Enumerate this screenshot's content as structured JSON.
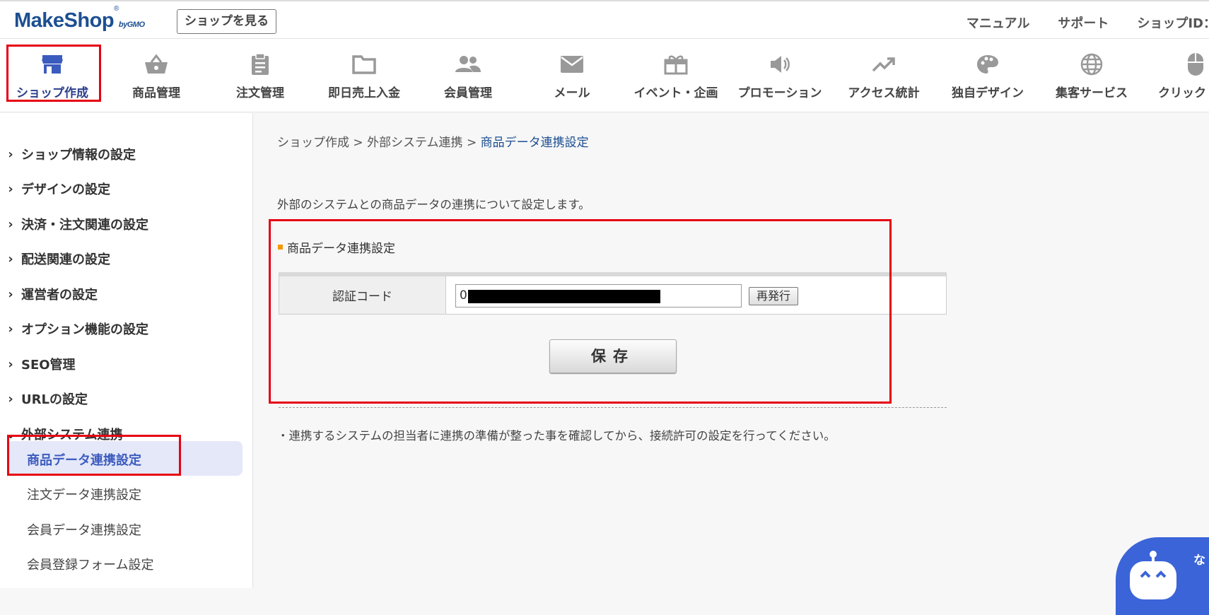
{
  "header": {
    "logo_main": "MakeShop",
    "logo_reg": "®",
    "logo_by": "byGMO",
    "view_shop_label": "ショップを見る",
    "links": [
      "マニュアル",
      "サポート",
      "ショップID："
    ]
  },
  "nav": {
    "items": [
      {
        "label": "ショップ作成",
        "icon": "store-icon",
        "active": true
      },
      {
        "label": "商品管理",
        "icon": "basket-icon"
      },
      {
        "label": "注文管理",
        "icon": "clipboard-icon"
      },
      {
        "label": "即日売上入金",
        "icon": "folder-icon"
      },
      {
        "label": "会員管理",
        "icon": "users-icon"
      },
      {
        "label": "メール",
        "icon": "mail-icon"
      },
      {
        "label": "イベント・企画",
        "icon": "gift-icon"
      },
      {
        "label": "プロモーション",
        "icon": "speaker-icon"
      },
      {
        "label": "アクセス統計",
        "icon": "trend-icon"
      },
      {
        "label": "独自デザイン",
        "icon": "palette-icon"
      },
      {
        "label": "集客サービス",
        "icon": "globe-icon"
      },
      {
        "label": "クリック",
        "icon": "mouse-icon"
      }
    ]
  },
  "sidebar": {
    "sections": [
      "ショップ情報の設定",
      "デザインの設定",
      "決済・注文関連の設定",
      "配送関連の設定",
      "運営者の設定",
      "オプション機能の設定",
      "SEO管理",
      "URLの設定",
      "外部システム連携"
    ],
    "sub_items": [
      "商品データ連携設定",
      "注文データ連携設定",
      "会員データ連携設定",
      "会員登録フォーム設定"
    ]
  },
  "main": {
    "breadcrumb": {
      "part1": "ショップ作成",
      "sep": " > ",
      "part2": "外部システム連携",
      "current": "商品データ連携設定"
    },
    "description": "外部のシステムとの商品データの連携について設定します。",
    "section_title": "商品データ連携設定",
    "auth_code_label": "認証コード",
    "auth_code_value": "0",
    "reissue_label": "再発行",
    "save_label": "保存",
    "note": "・連携するシステムの担当者に連携の準備が整った事を確認してから、接続許可の設定を行ってください。"
  },
  "chatbot": {
    "text": "な"
  },
  "colors": {
    "brand": "#1d4f91",
    "highlight": "#e60012",
    "accent_orange": "#f39800",
    "chat": "#3b64d8"
  }
}
